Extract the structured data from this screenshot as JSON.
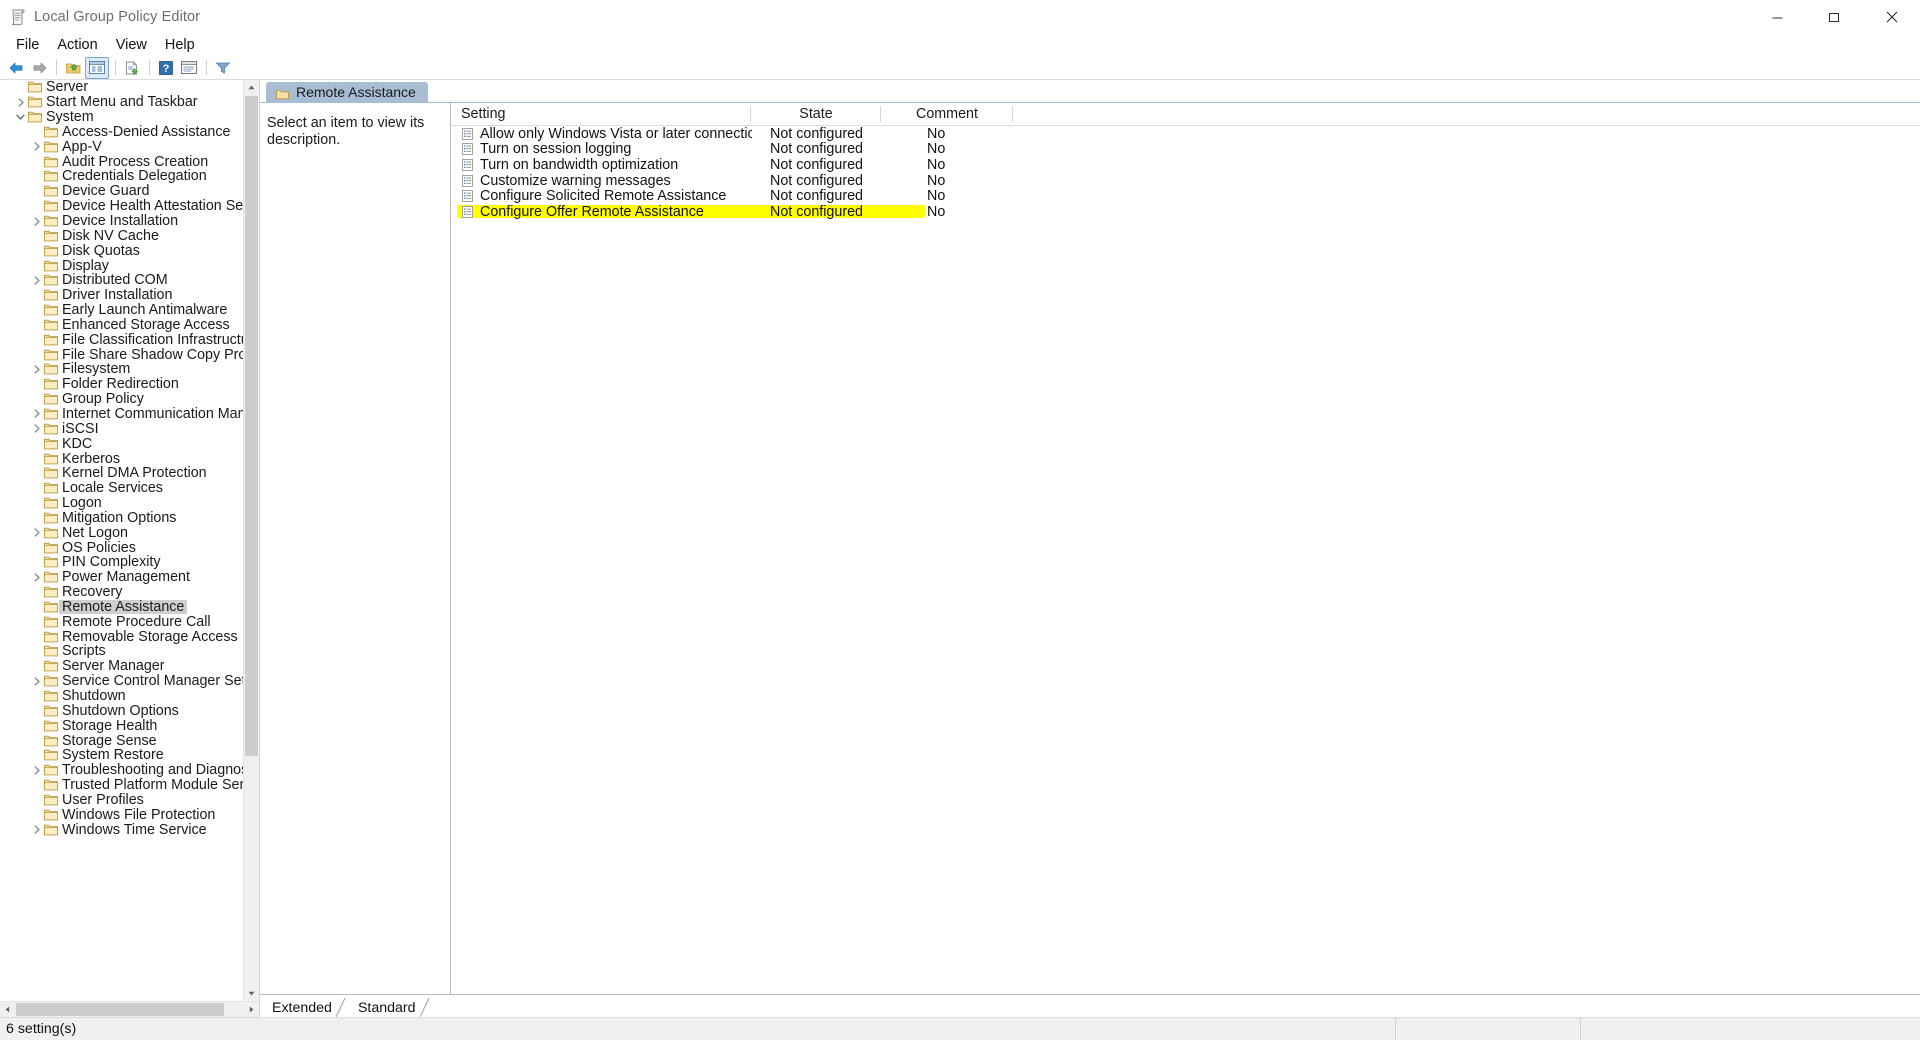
{
  "window": {
    "title": "Local Group Policy Editor",
    "icon": "group-policy-scroll-icon",
    "minimize_label": "Minimize",
    "maximize_label": "Maximize",
    "close_label": "Close"
  },
  "menubar": {
    "items": [
      {
        "label": "File"
      },
      {
        "label": "Action"
      },
      {
        "label": "View"
      },
      {
        "label": "Help"
      }
    ]
  },
  "toolbar": {
    "buttons": [
      {
        "name": "back-button",
        "icon": "back-arrow-icon"
      },
      {
        "name": "forward-button",
        "icon": "forward-arrow-icon"
      },
      {
        "name": "up-one-level-button",
        "icon": "folder-up-icon"
      },
      {
        "name": "show-hide-console-tree-button",
        "icon": "console-tree-icon",
        "selected": true
      },
      {
        "name": "properties-button",
        "icon": "properties-page-icon"
      },
      {
        "name": "help-button",
        "icon": "question-mark-icon"
      },
      {
        "name": "show-hide-action-pane-button",
        "icon": "action-pane-icon"
      },
      {
        "name": "filter-button",
        "icon": "filter-funnel-icon"
      }
    ]
  },
  "tree": {
    "items": [
      {
        "label": "Server",
        "depth": 2,
        "expander": "none"
      },
      {
        "label": "Start Menu and Taskbar",
        "depth": 2,
        "expander": "collapsed"
      },
      {
        "label": "System",
        "depth": 2,
        "expander": "expanded"
      },
      {
        "label": "Access-Denied Assistance",
        "depth": 3,
        "expander": "none"
      },
      {
        "label": "App-V",
        "depth": 3,
        "expander": "collapsed"
      },
      {
        "label": "Audit Process Creation",
        "depth": 3,
        "expander": "none"
      },
      {
        "label": "Credentials Delegation",
        "depth": 3,
        "expander": "none"
      },
      {
        "label": "Device Guard",
        "depth": 3,
        "expander": "none"
      },
      {
        "label": "Device Health Attestation Service",
        "depth": 3,
        "expander": "none"
      },
      {
        "label": "Device Installation",
        "depth": 3,
        "expander": "collapsed"
      },
      {
        "label": "Disk NV Cache",
        "depth": 3,
        "expander": "none"
      },
      {
        "label": "Disk Quotas",
        "depth": 3,
        "expander": "none"
      },
      {
        "label": "Display",
        "depth": 3,
        "expander": "none"
      },
      {
        "label": "Distributed COM",
        "depth": 3,
        "expander": "collapsed"
      },
      {
        "label": "Driver Installation",
        "depth": 3,
        "expander": "none"
      },
      {
        "label": "Early Launch Antimalware",
        "depth": 3,
        "expander": "none"
      },
      {
        "label": "Enhanced Storage Access",
        "depth": 3,
        "expander": "none"
      },
      {
        "label": "File Classification Infrastructure",
        "depth": 3,
        "expander": "none"
      },
      {
        "label": "File Share Shadow Copy Provider",
        "depth": 3,
        "expander": "none"
      },
      {
        "label": "Filesystem",
        "depth": 3,
        "expander": "collapsed"
      },
      {
        "label": "Folder Redirection",
        "depth": 3,
        "expander": "none"
      },
      {
        "label": "Group Policy",
        "depth": 3,
        "expander": "none"
      },
      {
        "label": "Internet Communication Management",
        "depth": 3,
        "expander": "collapsed"
      },
      {
        "label": "iSCSI",
        "depth": 3,
        "expander": "collapsed"
      },
      {
        "label": "KDC",
        "depth": 3,
        "expander": "none"
      },
      {
        "label": "Kerberos",
        "depth": 3,
        "expander": "none"
      },
      {
        "label": "Kernel DMA Protection",
        "depth": 3,
        "expander": "none"
      },
      {
        "label": "Locale Services",
        "depth": 3,
        "expander": "none"
      },
      {
        "label": "Logon",
        "depth": 3,
        "expander": "none"
      },
      {
        "label": "Mitigation Options",
        "depth": 3,
        "expander": "none"
      },
      {
        "label": "Net Logon",
        "depth": 3,
        "expander": "collapsed"
      },
      {
        "label": "OS Policies",
        "depth": 3,
        "expander": "none"
      },
      {
        "label": "PIN Complexity",
        "depth": 3,
        "expander": "none"
      },
      {
        "label": "Power Management",
        "depth": 3,
        "expander": "collapsed"
      },
      {
        "label": "Recovery",
        "depth": 3,
        "expander": "none"
      },
      {
        "label": "Remote Assistance",
        "depth": 3,
        "expander": "none",
        "selected": true
      },
      {
        "label": "Remote Procedure Call",
        "depth": 3,
        "expander": "none"
      },
      {
        "label": "Removable Storage Access",
        "depth": 3,
        "expander": "none"
      },
      {
        "label": "Scripts",
        "depth": 3,
        "expander": "none"
      },
      {
        "label": "Server Manager",
        "depth": 3,
        "expander": "none"
      },
      {
        "label": "Service Control Manager Settings",
        "depth": 3,
        "expander": "collapsed"
      },
      {
        "label": "Shutdown",
        "depth": 3,
        "expander": "none"
      },
      {
        "label": "Shutdown Options",
        "depth": 3,
        "expander": "none"
      },
      {
        "label": "Storage Health",
        "depth": 3,
        "expander": "none"
      },
      {
        "label": "Storage Sense",
        "depth": 3,
        "expander": "none"
      },
      {
        "label": "System Restore",
        "depth": 3,
        "expander": "none"
      },
      {
        "label": "Troubleshooting and Diagnostics",
        "depth": 3,
        "expander": "collapsed"
      },
      {
        "label": "Trusted Platform Module Services",
        "depth": 3,
        "expander": "none"
      },
      {
        "label": "User Profiles",
        "depth": 3,
        "expander": "none"
      },
      {
        "label": "Windows File Protection",
        "depth": 3,
        "expander": "none"
      },
      {
        "label": "Windows Time Service",
        "depth": 3,
        "expander": "collapsed"
      }
    ]
  },
  "details": {
    "header_tab": "Remote Assistance",
    "description": "Select an item to view its description.",
    "columns": [
      {
        "label": "Setting"
      },
      {
        "label": "State"
      },
      {
        "label": "Comment"
      }
    ],
    "rows": [
      {
        "setting": "Allow only Windows Vista or later connections",
        "state": "Not configured",
        "comment": "No"
      },
      {
        "setting": "Turn on session logging",
        "state": "Not configured",
        "comment": "No"
      },
      {
        "setting": "Turn on bandwidth optimization",
        "state": "Not configured",
        "comment": "No"
      },
      {
        "setting": "Customize warning messages",
        "state": "Not configured",
        "comment": "No"
      },
      {
        "setting": "Configure Solicited Remote Assistance",
        "state": "Not configured",
        "comment": "No"
      },
      {
        "setting": "Configure Offer Remote Assistance",
        "state": "Not configured",
        "comment": "No",
        "highlighted": true
      }
    ]
  },
  "view_tabs": [
    {
      "label": "Extended",
      "active": false
    },
    {
      "label": "Standard",
      "active": true
    }
  ],
  "statusbar": {
    "text": "6 setting(s)"
  },
  "colors": {
    "tab_header": "#a8bcd4",
    "highlight_marker": "#ffff00",
    "tree_selection": "#cfcfcf",
    "folder": "#fadf9a",
    "toolbar_selected": "#dcebfb"
  }
}
